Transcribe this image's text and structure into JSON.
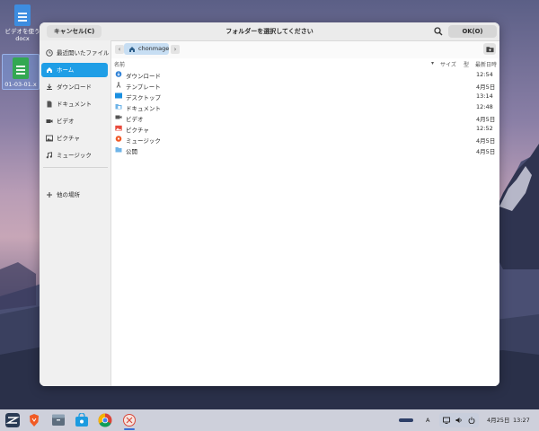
{
  "dialog": {
    "cancel_label": "キャンセル(C)",
    "title": "フォルダーを選択してください",
    "ok_label": "OK(O)"
  },
  "sidebar": {
    "items": [
      {
        "label": "最近開いたファイル",
        "icon": "clock-icon"
      },
      {
        "label": "ホーム",
        "icon": "home-icon",
        "active": true
      },
      {
        "label": "ダウンロード",
        "icon": "download-icon"
      },
      {
        "label": "ドキュメント",
        "icon": "document-icon"
      },
      {
        "label": "ビデオ",
        "icon": "video-icon"
      },
      {
        "label": "ピクチャ",
        "icon": "picture-icon"
      },
      {
        "label": "ミュージック",
        "icon": "music-icon"
      }
    ],
    "other_places_label": "他の場所"
  },
  "pathbar": {
    "current": "chonmage"
  },
  "columns": {
    "name": "名前",
    "size": "サイズ",
    "type": "型",
    "modified": "最新日時"
  },
  "files": [
    {
      "name": "ダウンロード",
      "modified": "12:54",
      "icon": "download-folder-icon"
    },
    {
      "name": "テンプレート",
      "modified": "4月5日",
      "icon": "template-folder-icon"
    },
    {
      "name": "デスクトップ",
      "modified": "13:14",
      "icon": "desktop-folder-icon"
    },
    {
      "name": "ドキュメント",
      "modified": "12:48",
      "icon": "documents-folder-icon"
    },
    {
      "name": "ビデオ",
      "modified": "4月5日",
      "icon": "videos-folder-icon"
    },
    {
      "name": "ピクチャ",
      "modified": "12:52",
      "icon": "pictures-folder-icon"
    },
    {
      "name": "ミュージック",
      "modified": "4月5日",
      "icon": "music-folder-icon"
    },
    {
      "name": "公開",
      "modified": "4月5日",
      "icon": "public-folder-icon"
    }
  ],
  "desktop": {
    "icon1_label_line1": "ビデオを使う",
    "icon1_label_line2": "docx",
    "icon2_label": "01-03-01.x"
  },
  "taskbar": {
    "input_method": "A",
    "date": "4月25日",
    "time": "13:27"
  },
  "colors": {
    "accent": "#1f9ee6",
    "crumb_bg": "#c7def3"
  }
}
